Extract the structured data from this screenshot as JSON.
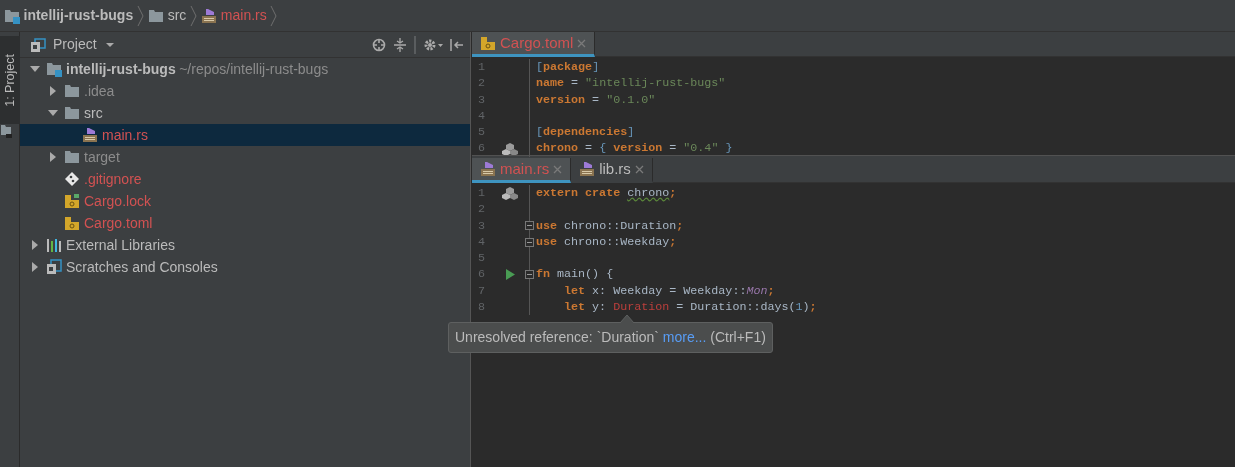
{
  "breadcrumbs": [
    {
      "kind": "module",
      "label": "intellij-rust-bugs",
      "untracked": false
    },
    {
      "kind": "folder",
      "label": "src",
      "untracked": false
    },
    {
      "kind": "rust",
      "label": "main.rs",
      "untracked": true
    }
  ],
  "tool_windows": [
    {
      "label": "1: Project",
      "selected": true
    }
  ],
  "project_panel": {
    "title": "Project",
    "tree": [
      {
        "kind": "module",
        "label": "intellij-rust-bugs",
        "path": "~/repos/intellij-rust-bugs",
        "expanded": true,
        "selected": false,
        "untracked": false,
        "children": [
          {
            "kind": "folder",
            "label": ".idea",
            "expanded": false,
            "selected": false,
            "untracked": false,
            "excluded": true
          },
          {
            "kind": "folder",
            "label": "src",
            "expanded": true,
            "selected": false,
            "untracked": false,
            "children": [
              {
                "kind": "rust",
                "label": "main.rs",
                "selected": true,
                "untracked": true
              }
            ]
          },
          {
            "kind": "folder",
            "label": "target",
            "expanded": false,
            "selected": false,
            "untracked": false,
            "excluded": true
          },
          {
            "kind": "gitignore",
            "label": ".gitignore",
            "selected": false,
            "untracked": true
          },
          {
            "kind": "cargo-lock",
            "label": "Cargo.lock",
            "selected": false,
            "untracked": true
          },
          {
            "kind": "cargo",
            "label": "Cargo.toml",
            "selected": false,
            "untracked": true
          }
        ]
      },
      {
        "kind": "libraries",
        "label": "External Libraries",
        "expanded": false,
        "selected": false,
        "untracked": false
      },
      {
        "kind": "scratches",
        "label": "Scratches and Consoles",
        "expanded": false,
        "selected": false,
        "untracked": false
      }
    ]
  },
  "editors": [
    {
      "tabs": [
        {
          "kind": "cargo",
          "label": "Cargo.toml",
          "selected": true,
          "untracked": true
        }
      ],
      "lines": [
        {
          "number": "1",
          "kind": "plain",
          "tokens": [
            {
              "kind": "bracket",
              "text": "["
            },
            {
              "kind": "key",
              "text": "package"
            },
            {
              "kind": "bracket",
              "text": "]"
            }
          ]
        },
        {
          "number": "2",
          "kind": "plain",
          "tokens": [
            {
              "kind": "key",
              "text": "name"
            },
            {
              "kind": "plain",
              "text": " = "
            },
            {
              "kind": "string",
              "text": "\"intellij-rust-bugs\""
            }
          ]
        },
        {
          "number": "3",
          "kind": "plain",
          "tokens": [
            {
              "kind": "key",
              "text": "version"
            },
            {
              "kind": "plain",
              "text": " = "
            },
            {
              "kind": "string",
              "text": "\"0.1.0\""
            }
          ]
        },
        {
          "number": "4",
          "kind": "plain"
        },
        {
          "number": "5",
          "kind": "plain",
          "tokens": [
            {
              "kind": "bracket",
              "text": "["
            },
            {
              "kind": "key",
              "text": "dependencies"
            },
            {
              "kind": "bracket",
              "text": "]"
            }
          ]
        },
        {
          "number": "6",
          "kind": "crate",
          "tokens": [
            {
              "kind": "key",
              "text": "chrono"
            },
            {
              "kind": "plain",
              "text": " = "
            },
            {
              "kind": "bracket",
              "text": "{ "
            },
            {
              "kind": "key",
              "text": "version"
            },
            {
              "kind": "plain",
              "text": " = "
            },
            {
              "kind": "string",
              "text": "\"0.4\""
            },
            {
              "kind": "bracket",
              "text": " }"
            }
          ]
        }
      ]
    },
    {
      "tabs": [
        {
          "kind": "rust",
          "label": "main.rs",
          "selected": true,
          "untracked": true
        },
        {
          "kind": "rust",
          "label": "lib.rs",
          "selected": false,
          "untracked": false
        }
      ],
      "lines": [
        {
          "number": "1",
          "kind": "crate",
          "fold": false,
          "tokens": [
            {
              "kind": "keyword",
              "text": "extern crate "
            },
            {
              "kind": "warning",
              "text": "chrono"
            },
            {
              "kind": "keyword",
              "text": ";"
            }
          ]
        },
        {
          "number": "2",
          "kind": "plain",
          "fold": false
        },
        {
          "number": "3",
          "kind": "plain",
          "fold": true,
          "tokens": [
            {
              "kind": "keyword",
              "text": "use "
            },
            {
              "kind": "plain",
              "text": "chrono::Duration"
            },
            {
              "kind": "keyword",
              "text": ";"
            }
          ]
        },
        {
          "number": "4",
          "kind": "plain",
          "fold": true,
          "tokens": [
            {
              "kind": "keyword",
              "text": "use "
            },
            {
              "kind": "plain",
              "text": "chrono::Weekday"
            },
            {
              "kind": "keyword",
              "text": ";"
            }
          ]
        },
        {
          "number": "5",
          "kind": "plain",
          "fold": false
        },
        {
          "number": "6",
          "kind": "run",
          "fold": true,
          "tokens": [
            {
              "kind": "keyword",
              "text": "fn "
            },
            {
              "kind": "plain",
              "text": "main() {"
            }
          ]
        },
        {
          "number": "7",
          "kind": "plain",
          "fold": false,
          "nested": true,
          "tokens": [
            {
              "kind": "keyword",
              "text": "let "
            },
            {
              "kind": "plain",
              "text": "x: Weekday = Weekday::"
            },
            {
              "kind": "constant",
              "text": "Mon"
            },
            {
              "kind": "keyword",
              "text": ";"
            }
          ]
        },
        {
          "number": "8",
          "kind": "plain",
          "fold": false,
          "nested": true,
          "tokens": [
            {
              "kind": "keyword",
              "text": "let "
            },
            {
              "kind": "plain",
              "text": "y: "
            },
            {
              "kind": "error",
              "text": "Duration"
            },
            {
              "kind": "plain",
              "text": " = Duration::days("
            },
            {
              "kind": "number",
              "text": "1"
            },
            {
              "kind": "plain",
              "text": ")"
            },
            {
              "kind": "keyword",
              "text": ";"
            }
          ]
        }
      ]
    }
  ],
  "tooltip": {
    "text": "Unresolved reference: `Duration`",
    "link": "more...",
    "shortcut": "(Ctrl+F1)"
  }
}
